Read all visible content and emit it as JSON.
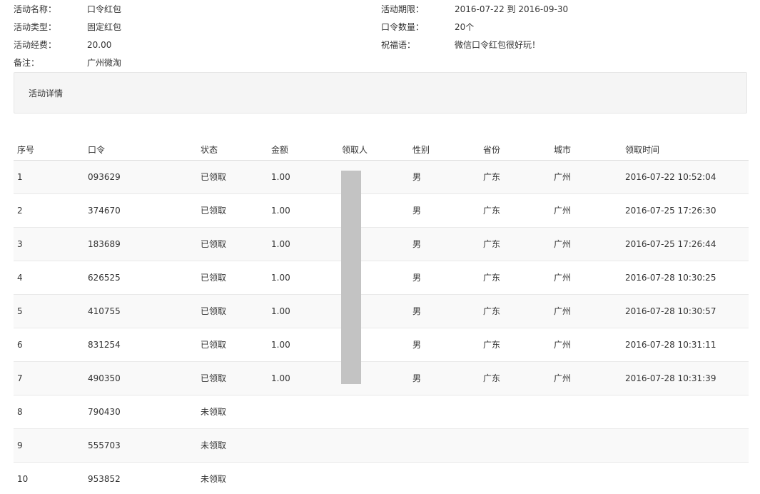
{
  "info": {
    "activity_name_label": "活动名称：",
    "activity_name": "口令红包",
    "activity_type_label": "活动类型：",
    "activity_type": "固定红包",
    "activity_fee_label": "活动经费：",
    "activity_fee": "20.00",
    "remark_label": "备注：",
    "remark": "广州微淘",
    "period_label": "活动期限：",
    "period": "2016-07-22 到 2016-09-30",
    "code_count_label": "口令数量：",
    "code_count": "20个",
    "greeting_label": "祝福语：",
    "greeting": "微信口令红包很好玩！"
  },
  "detail": {
    "title": "活动详情"
  },
  "table": {
    "headers": [
      "序号",
      "口令",
      "状态",
      "金额",
      "领取人",
      "性别",
      "省份",
      "城市",
      "领取时间"
    ],
    "rows": [
      [
        "1",
        "093629",
        "已领取",
        "1.00",
        "",
        "男",
        "广东",
        "广州",
        "2016-07-22 10:52:04"
      ],
      [
        "2",
        "374670",
        "已领取",
        "1.00",
        "",
        "男",
        "广东",
        "广州",
        "2016-07-25 17:26:30"
      ],
      [
        "3",
        "183689",
        "已领取",
        "1.00",
        "",
        "男",
        "广东",
        "广州",
        "2016-07-25 17:26:44"
      ],
      [
        "4",
        "626525",
        "已领取",
        "1.00",
        "",
        "男",
        "广东",
        "广州",
        "2016-07-28 10:30:25"
      ],
      [
        "5",
        "410755",
        "已领取",
        "1.00",
        "",
        "男",
        "广东",
        "广州",
        "2016-07-28 10:30:57"
      ],
      [
        "6",
        "831254",
        "已领取",
        "1.00",
        "",
        "男",
        "广东",
        "广州",
        "2016-07-28 10:31:11"
      ],
      [
        "7",
        "490350",
        "已领取",
        "1.00",
        "",
        "男",
        "广东",
        "广州",
        "2016-07-28 10:31:39"
      ],
      [
        "8",
        "790430",
        "未领取",
        "",
        "",
        "",
        "",
        "",
        ""
      ],
      [
        "9",
        "555703",
        "未领取",
        "",
        "",
        "",
        "",
        "",
        ""
      ],
      [
        "10",
        "953852",
        "未领取",
        "",
        "",
        "",
        "",
        "",
        ""
      ]
    ]
  }
}
